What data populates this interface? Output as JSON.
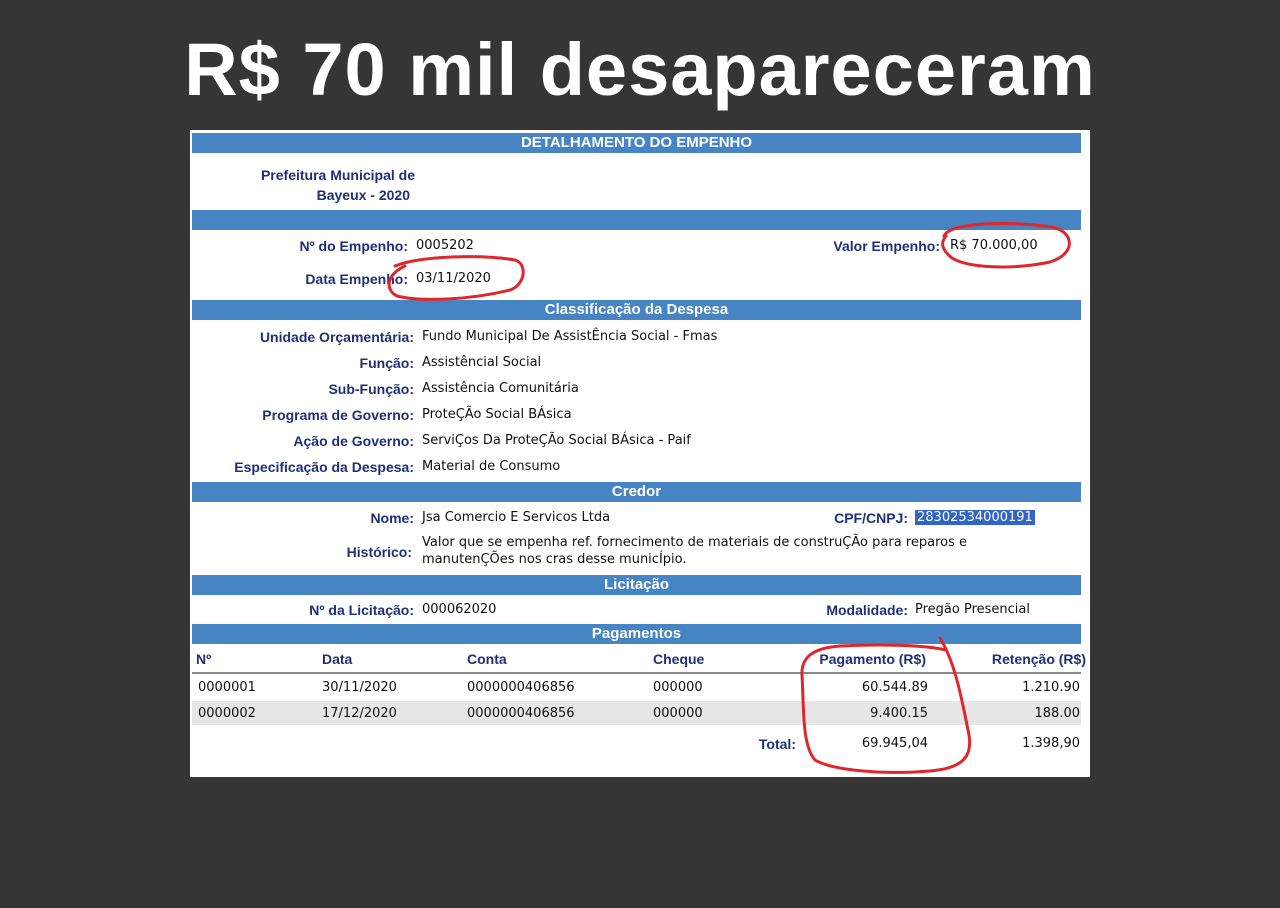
{
  "headline": "R$ 70 mil desapareceram",
  "panel": {
    "title": "DETALHAMENTO DO EMPENHO",
    "org_line1": "Prefeitura Municipal de",
    "org_line2": "Bayeux - 2020",
    "empenho": {
      "numero_label": "Nº do Empenho:",
      "numero_value": "0005202",
      "data_label": "Data Empenho:",
      "data_value": "03/11/2020",
      "valor_label": "Valor Empenho:",
      "valor_value": "R$ 70.000,00"
    },
    "classificacao": {
      "title": "Classificação da Despesa",
      "fields": [
        {
          "label": "Unidade Orçamentária:",
          "value": "Fundo Municipal De AssistÊncia Social - Fmas"
        },
        {
          "label": "Função:",
          "value": "Assistêncial Social"
        },
        {
          "label": "Sub-Função:",
          "value": "Assistência Comunitária"
        },
        {
          "label": "Programa de Governo:",
          "value": "ProteÇÃo Social BÁsica"
        },
        {
          "label": "Ação de Governo:",
          "value": "ServiÇos Da ProteÇÃo Social BÁsica - Paif"
        },
        {
          "label": "Especificação da Despesa:",
          "value": "Material de Consumo"
        }
      ]
    },
    "credor": {
      "title": "Credor",
      "nome_label": "Nome:",
      "nome_value": "Jsa Comercio E Servicos Ltda",
      "cnpj_label": "CPF/CNPJ:",
      "cnpj_value": "28302534000191",
      "historico_label": "Histórico:",
      "historico_line1": "Valor que se empenha ref. fornecimento de materiais de construÇÃo para reparos e",
      "historico_line2": "manutenÇÕes nos cras desse municÍpio."
    },
    "licitacao": {
      "title": "Licitação",
      "numero_label": "Nº da Licitação:",
      "numero_value": "000062020",
      "modalidade_label": "Modalidade:",
      "modalidade_value": "Pregão Presencial"
    },
    "pagamentos": {
      "title": "Pagamentos",
      "columns": [
        "Nº",
        "Data",
        "Conta",
        "Cheque",
        "Pagamento (R$)",
        "Retenção (R$)"
      ],
      "rows": [
        {
          "numero": "0000001",
          "data": "30/11/2020",
          "conta": "0000000406856",
          "cheque": "000000",
          "pagamento": "60.544.89",
          "retencao": "1.210.90"
        },
        {
          "numero": "0000002",
          "data": "17/12/2020",
          "conta": "0000000406856",
          "cheque": "000000",
          "pagamento": "9.400.15",
          "retencao": "188.00"
        }
      ],
      "total_label": "Total:",
      "total_pagamento": "69.945,04",
      "total_retencao": "1.398,90"
    }
  },
  "annotation_color": "#e0262b"
}
